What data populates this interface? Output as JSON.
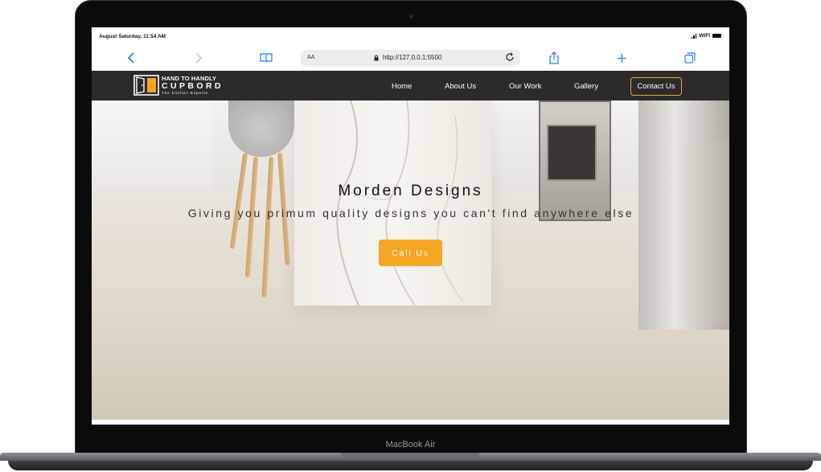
{
  "status_bar": {
    "datetime": "August Saturday, 11:54 AM",
    "wifi": "WIFI"
  },
  "browser": {
    "text_size": "AA",
    "url": "http://127.0.0.1:5500"
  },
  "site": {
    "logo": {
      "line1": "HAND TO HANDLY",
      "line2": "CUPBORD",
      "line3": "The kitchen Experts"
    },
    "nav": {
      "items": [
        "Home",
        "About Us",
        "Our Work",
        "Gallery"
      ],
      "cta": "Contact Us"
    },
    "hero": {
      "title": "Morden Designs",
      "subtitle": "Giving you primum quality designs you can't find anywhere else",
      "button": "Call Us"
    }
  },
  "device": {
    "label": "MacBook Air"
  },
  "colors": {
    "accent": "#f5a623",
    "nav_bg": "#2b2b2b",
    "browser_blue": "#1f7cf5"
  }
}
